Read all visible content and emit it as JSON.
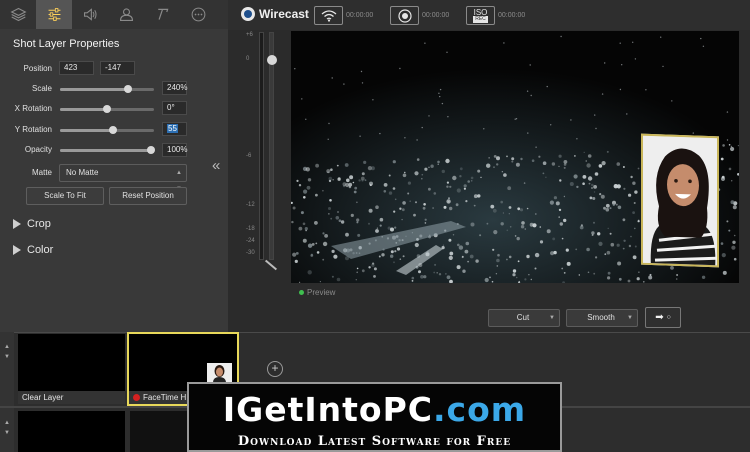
{
  "app": {
    "name": "Wirecast",
    "stream_time": "00:00:00",
    "record_time": "00:00:00",
    "iso_time": "00:00:00",
    "iso_label_top": "ISO",
    "iso_label_bottom": "REC"
  },
  "tabs": [
    {
      "icon": "layers-icon",
      "active": false
    },
    {
      "icon": "sliders-icon",
      "active": true
    },
    {
      "icon": "speaker-icon",
      "active": false
    },
    {
      "icon": "person-icon",
      "active": false
    },
    {
      "icon": "text-icon",
      "active": false
    },
    {
      "icon": "more-icon",
      "active": false
    }
  ],
  "properties": {
    "title": "Shot Layer Properties",
    "position_label": "Position",
    "position_x": "423",
    "position_y": "-147",
    "scale_label": "Scale",
    "scale_value": "240%",
    "scale_level": 0.72,
    "xrot_label": "X Rotation",
    "xrot_value": "0°",
    "xrot_level": 0.5,
    "yrot_label": "Y Rotation",
    "yrot_value": "55",
    "yrot_level": 0.56,
    "opacity_label": "Opacity",
    "opacity_value": "100%",
    "opacity_level": 1.0,
    "matte_label": "Matte",
    "matte_value": "No Matte",
    "scale_to_fit": "Scale To Fit",
    "reset_position": "Reset Position",
    "crop": "Crop",
    "color": "Color"
  },
  "meter": {
    "ticks": [
      "+6",
      "0",
      "-6",
      "-12",
      "-18",
      "-24",
      "-30"
    ]
  },
  "preview": {
    "label": "Preview"
  },
  "transitions": {
    "transition_1": "Cut",
    "transition_2": "Smooth"
  },
  "shots": [
    {
      "label": "Clear Layer"
    },
    {
      "label": "FaceTime H"
    }
  ],
  "watermark": {
    "line1_a": "IGetIntoPC",
    "line1_b": ".com",
    "line2": "Download Latest Software for Free"
  },
  "colors": {
    "accent_yellow": "#e8d85a",
    "live_red": "#d42020",
    "preview_green": "#3fbf4f",
    "watermark_blue": "#3ba8e8"
  }
}
